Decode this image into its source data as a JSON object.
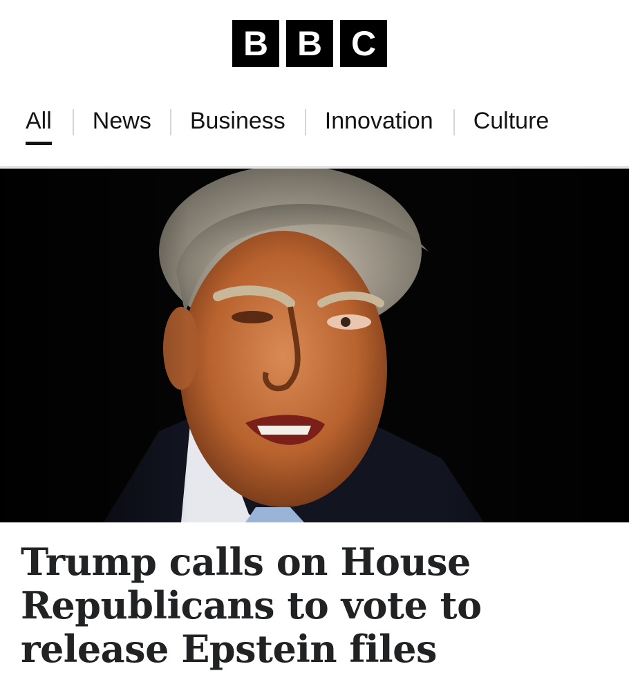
{
  "header": {
    "logo_letters": [
      "B",
      "B",
      "C"
    ]
  },
  "nav": {
    "items": [
      {
        "label": "All",
        "active": true
      },
      {
        "label": "News",
        "active": false
      },
      {
        "label": "Business",
        "active": false
      },
      {
        "label": "Innovation",
        "active": false
      },
      {
        "label": "Culture",
        "active": false
      }
    ]
  },
  "hero": {
    "icon": "news-photo"
  },
  "article": {
    "headline": "Trump calls on House Republicans to vote to release Epstein files"
  },
  "colors": {
    "logo_bg": "#000000",
    "logo_fg": "#ffffff",
    "text": "#202224",
    "nav_underline": "#141414"
  }
}
